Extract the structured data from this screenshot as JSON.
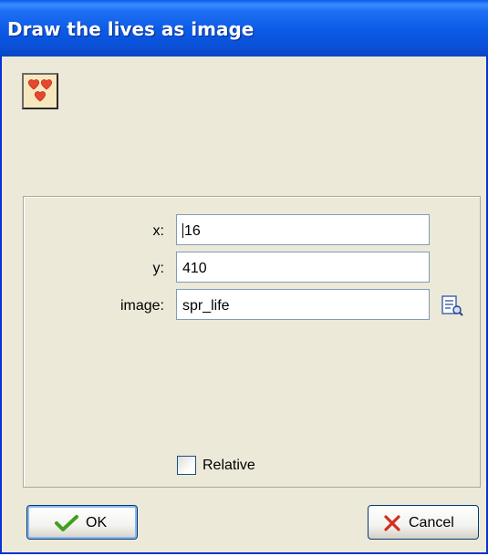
{
  "window": {
    "title": "Draw the lives as image",
    "icon": "hearts-icon"
  },
  "fields": {
    "x": {
      "label": "x:",
      "value": "16"
    },
    "y": {
      "label": "y:",
      "value": "410"
    },
    "image": {
      "label": "image:",
      "value": "spr_life",
      "browse_icon": "sprite-browse-icon"
    }
  },
  "relative": {
    "label": "Relative",
    "checked": false
  },
  "buttons": {
    "ok": {
      "label": "OK",
      "icon": "checkmark-icon"
    },
    "cancel": {
      "label": "Cancel",
      "icon": "cross-icon"
    }
  },
  "colors": {
    "titlebar": "#0a5ce6",
    "dialog_bg": "#ece9d8",
    "ok_check": "#3fa01f",
    "cancel_cross": "#d2301f"
  }
}
